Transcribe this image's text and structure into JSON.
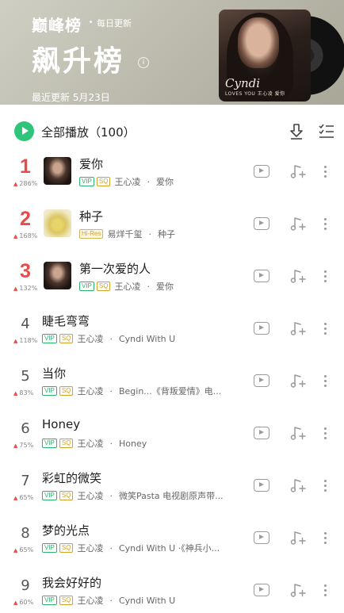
{
  "header": {
    "brand": "巅峰榜",
    "daily": "每日更新",
    "title": "飙升榜",
    "info": "i",
    "updated": "最近更新 5月23日",
    "cover_artist": "Cyndi",
    "cover_sub": "LOVES YOU 王心凌 爱你"
  },
  "playall": {
    "label": "全部播放（100）"
  },
  "songs": [
    {
      "rank": "1",
      "trend": "286%",
      "title": "爱你",
      "tags": [
        "VIP",
        "SQ"
      ],
      "artist": "王心凌",
      "album": "爱你",
      "thumb": "cyndi"
    },
    {
      "rank": "2",
      "trend": "168%",
      "title": "种子",
      "tags": [
        "Hi-Res"
      ],
      "artist": "易烊千玺",
      "album": "种子",
      "thumb": "seed"
    },
    {
      "rank": "3",
      "trend": "132%",
      "title": "第一次爱的人",
      "tags": [
        "VIP",
        "SQ"
      ],
      "artist": "王心凌",
      "album": "爱你",
      "thumb": "cyndi"
    },
    {
      "rank": "4",
      "trend": "118%",
      "title": "睫毛弯弯",
      "tags": [
        "VIP",
        "SQ"
      ],
      "artist": "王心凌",
      "album": "Cyndi With U"
    },
    {
      "rank": "5",
      "trend": "83%",
      "title": "当你",
      "tags": [
        "VIP",
        "SQ"
      ],
      "artist": "王心凌",
      "album": "Begin...《背叛爱情》电..."
    },
    {
      "rank": "6",
      "trend": "75%",
      "title": "Honey",
      "tags": [
        "VIP",
        "SQ"
      ],
      "artist": "王心凌",
      "album": "Honey"
    },
    {
      "rank": "7",
      "trend": "65%",
      "title": "彩虹的微笑",
      "tags": [
        "VIP",
        "SQ"
      ],
      "artist": "王心凌",
      "album": "微笑Pasta 电视剧原声带..."
    },
    {
      "rank": "8",
      "trend": "65%",
      "title": "梦的光点",
      "tags": [
        "VIP",
        "SQ"
      ],
      "artist": "王心凌",
      "album": "Cyndi With U ·《神兵小..."
    },
    {
      "rank": "9",
      "trend": "60%",
      "title": "我会好好的",
      "tags": [
        "VIP",
        "SQ"
      ],
      "artist": "王心凌",
      "album": "Cyndi With U"
    }
  ]
}
